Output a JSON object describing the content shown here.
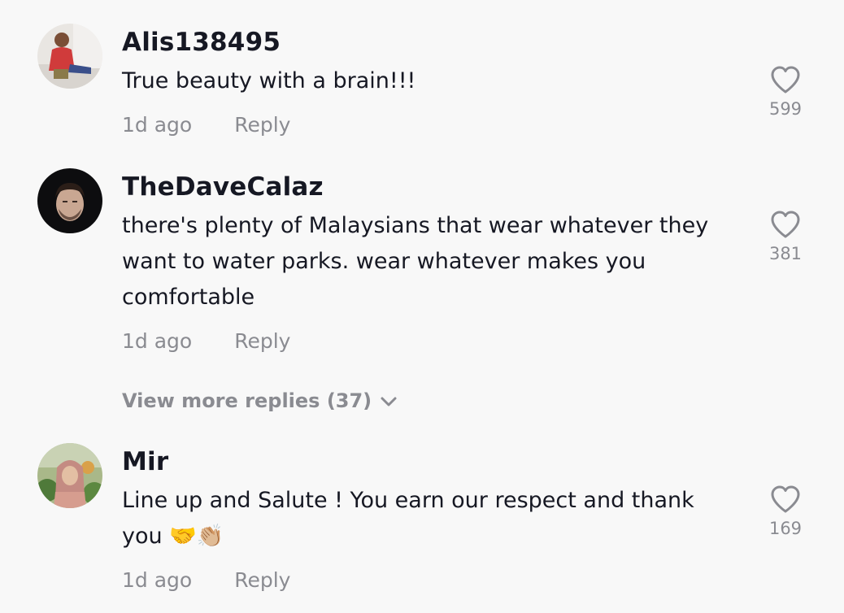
{
  "comments": [
    {
      "username": "Alis138495",
      "text": "True beauty with a brain!!!",
      "time": "1d ago",
      "reply_label": "Reply",
      "likes": "599"
    },
    {
      "username": "TheDaveCalaz",
      "text": "there's plenty of Malaysians that wear whatever they want to water parks. wear whatever makes you comfortable",
      "time": "1d ago",
      "reply_label": "Reply",
      "likes": "381"
    },
    {
      "username": "Mir",
      "text": "Line up and Salute ! You earn our respect and thank you 🤝👏🏼",
      "time": "1d ago",
      "reply_label": "Reply",
      "likes": "169"
    }
  ],
  "view_more_replies": "View more replies (37)",
  "colors": {
    "background": "#f8f8f8",
    "primary_text": "#161823",
    "secondary_text": "#8a8b91"
  },
  "icons": {
    "like": "heart-outline-icon",
    "expand": "chevron-down-icon"
  }
}
